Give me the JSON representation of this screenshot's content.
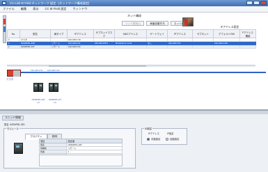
{
  "window": {
    "title": "CC-Link IE Field ネットワーク 設定 - [ネットワーク構成設定]"
  },
  "menu": [
    "ファイル",
    "編集",
    "表示",
    "CC IE Field 設定",
    "ウィンドウ"
  ],
  "grid_header": {
    "group_title": "ネット構成",
    "buttons": [
      "リンク更新(L)",
      "局番自動付与",
      "ネット番号"
    ],
    "right_group": "IPアドレス設定",
    "columns": [
      "No.",
      "型名",
      "局タイプ",
      "IPアドレス",
      "サブネットマスク",
      "MACアドレス",
      "ゲートウェイ",
      "IPアドレス",
      "サブネット",
      "デフォルトGW",
      "Pアドレス 確認"
    ]
  },
  "grid_rows": [
    {
      "cells": [
        "0",
        "マスタ",
        "",
        "192.168.3.39",
        "",
        "",
        "",
        "",
        "",
        "",
        ""
      ]
    },
    {
      "cells": [
        "1",
        "NZ2MFB1-32D",
        "リモート",
        "192.168.3.51",
        "255.255.255.0",
        "00:26:92:xx:xx:01",
        "なし",
        "192.168.3.51",
        "",
        "192.168.3.254",
        ""
      ]
    },
    {
      "cells": [
        "2",
        "NZ2MFB1-32T",
        "リモート",
        "192.168.3.52",
        "",
        "",
        "",
        "",
        "",
        "",
        ""
      ]
    }
  ],
  "topology": {
    "master_label": "マスタ",
    "nodes": [
      {
        "top": "192.168.3.51",
        "cap": "NZ2MFB1-32D\n(1)"
      },
      {
        "top": "192.168.3.52",
        "cap": "NZ2MFB1-32T\n(2)"
      }
    ]
  },
  "bottom": {
    "title": "ユニット情報",
    "selected_label": "型名: NZ2MFB1-32D",
    "module_group": "モジュール",
    "tabs": [
      "プロパティ",
      "説明"
    ],
    "properties_header": [
      "項目",
      "設定値"
    ],
    "properties": [
      [
        "型名",
        "NZ2MFB1-32D"
      ],
      [
        "局種別",
        "リモート"
      ],
      [
        "局番",
        "1"
      ],
      [
        "IP",
        "192.168.3.51"
      ],
      [
        "",
        ""
      ],
      [
        "",
        ""
      ]
    ],
    "right_group": "ID設定",
    "right_labels": [
      "IPアドレス",
      "IP設定"
    ],
    "radio_options": [
      {
        "label": "手動設定",
        "checked": true
      },
      {
        "label": "自動設定",
        "checked": false
      }
    ]
  },
  "colors": {
    "selection": "#2f69c8",
    "bus": "#2d62c4",
    "master": "#d9402e"
  }
}
